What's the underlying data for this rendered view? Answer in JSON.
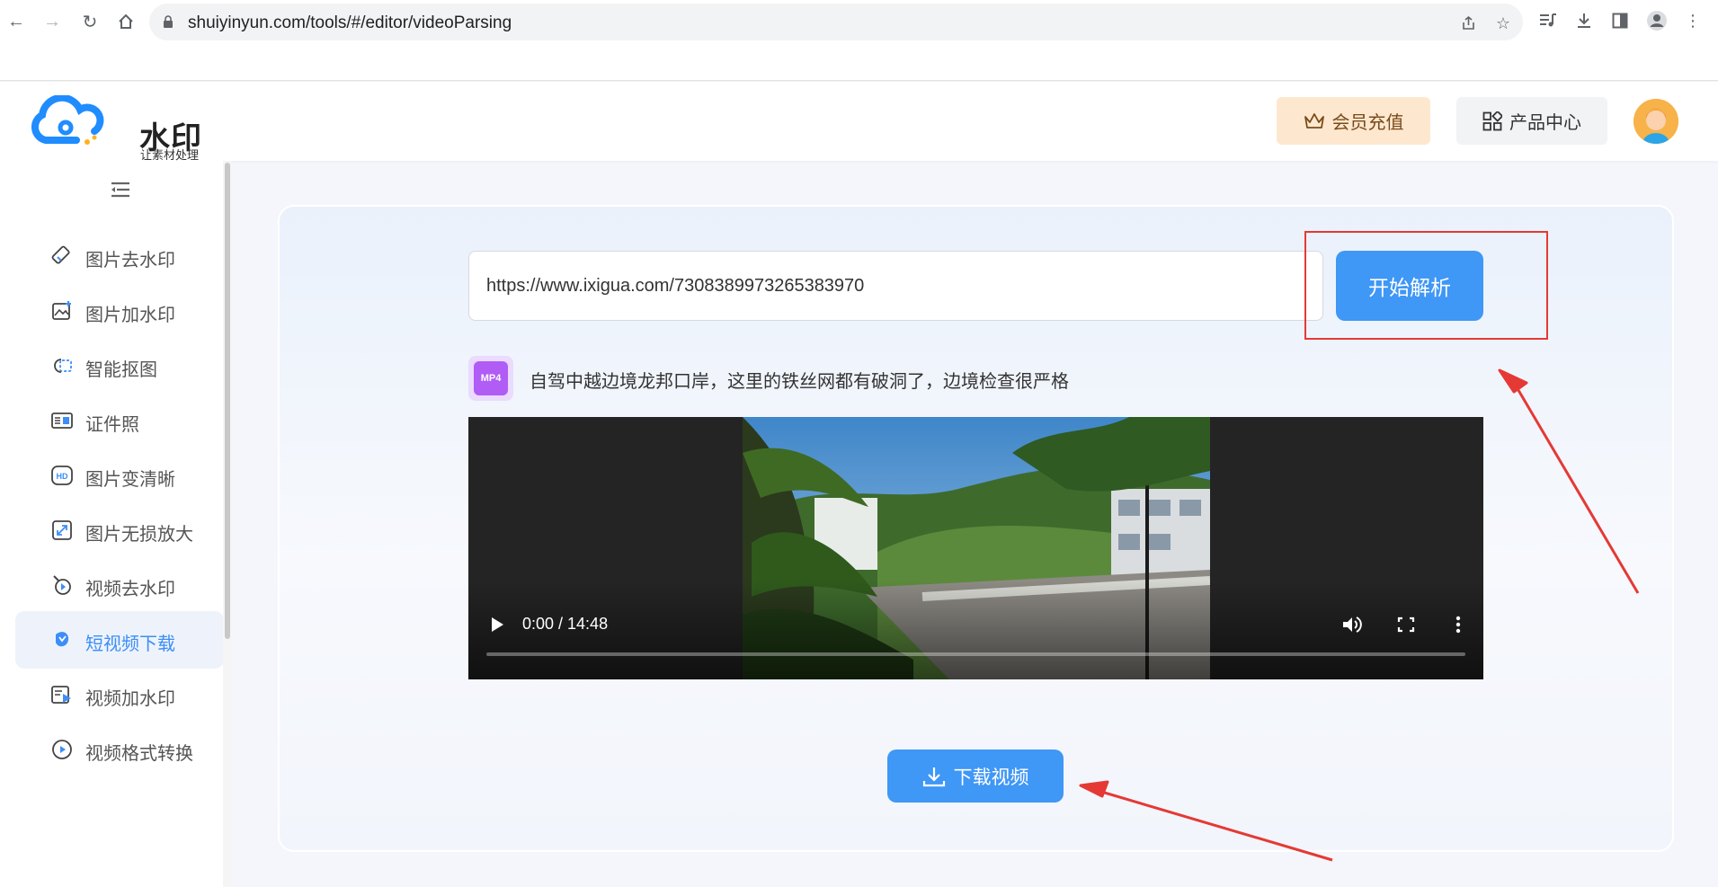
{
  "browser": {
    "url": "shuiyinyun.com/tools/#/editor/videoParsing"
  },
  "header": {
    "logo_name": "水印云",
    "logo_slogan": "让素材处理更简单",
    "vip_label": "会员充值",
    "products_label": "产品中心"
  },
  "sidebar": {
    "items": [
      {
        "label": "图片去水印",
        "icon": "eraser-icon"
      },
      {
        "label": "图片加水印",
        "icon": "image-add-icon"
      },
      {
        "label": "智能抠图",
        "icon": "cutout-icon"
      },
      {
        "label": "证件照",
        "icon": "id-card-icon"
      },
      {
        "label": "图片变清晰",
        "icon": "hd-icon"
      },
      {
        "label": "图片无损放大",
        "icon": "enlarge-icon"
      },
      {
        "label": "视频去水印",
        "icon": "video-eraser-icon"
      },
      {
        "label": "短视频下载",
        "icon": "download-leaf-icon"
      },
      {
        "label": "视频加水印",
        "icon": "video-add-icon"
      },
      {
        "label": "视频格式转换",
        "icon": "video-convert-icon"
      }
    ],
    "active_index": 7
  },
  "main": {
    "url_value": "https://www.ixigua.com/7308389973265383970",
    "parse_label": "开始解析",
    "file_badge": "MP4",
    "video_title": "自驾中越边境龙邦口岸，这里的铁丝网都有破洞了，边境检查很严格",
    "player_time": "0:00 / 14:48",
    "progress": 0,
    "download_label": "下载视频"
  },
  "colors": {
    "accent": "#3f97f6",
    "highlight": "#e53935",
    "vip_bg": "#fde8cf"
  }
}
